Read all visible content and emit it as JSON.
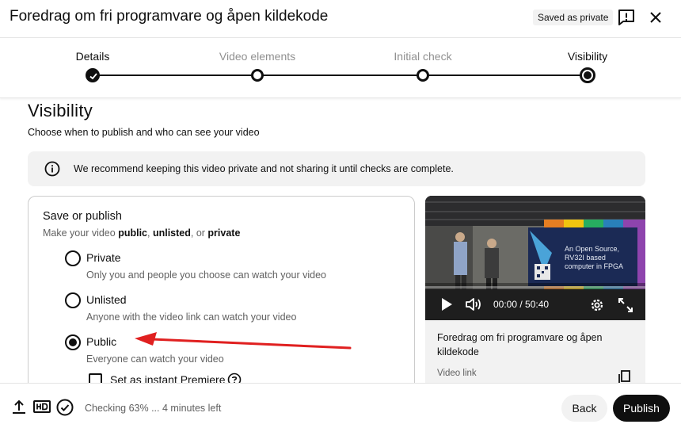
{
  "header": {
    "title": "Foredrag om fri programvare og åpen kildekode",
    "saved_badge": "Saved as private",
    "feedback_icon": "report-feedback-icon",
    "close_icon": "close-icon"
  },
  "stepper": {
    "steps": [
      {
        "label": "Details",
        "state": "done"
      },
      {
        "label": "Video elements",
        "state": "todo"
      },
      {
        "label": "Initial check",
        "state": "todo"
      },
      {
        "label": "Visibility",
        "state": "active"
      }
    ]
  },
  "visibility": {
    "title": "Visibility",
    "subtitle": "Choose when to publish and who can see your video",
    "banner": "We recommend keeping this video private and not sharing it until checks are complete."
  },
  "save_or_publish": {
    "title": "Save or publish",
    "subtitle_prefix": "Make your video ",
    "opt_public": "public",
    "sep1": ", ",
    "opt_unlisted": "unlisted",
    "sep2": ", or ",
    "opt_private": "private",
    "options": [
      {
        "label": "Private",
        "description": "Only you and people you choose can watch your video",
        "checked": false
      },
      {
        "label": "Unlisted",
        "description": "Anyone with the video link can watch your video",
        "checked": false
      },
      {
        "label": "Public",
        "description": "Everyone can watch your video",
        "checked": true
      }
    ],
    "premiere_label": "Set as instant Premiere"
  },
  "preview": {
    "screen_text": "An Open Source, RV32I based computer in FPGA",
    "time": "00:00 / 50:40",
    "title": "Foredrag om fri programvare og åpen kildekode",
    "video_link_label": "Video link"
  },
  "footer": {
    "status": "Checking 63% ... 4 minutes left",
    "back": "Back",
    "publish": "Publish"
  },
  "colors": {
    "accent": "#0f0f0f",
    "muted": "#606060",
    "annotation_arrow": "#e02020"
  }
}
